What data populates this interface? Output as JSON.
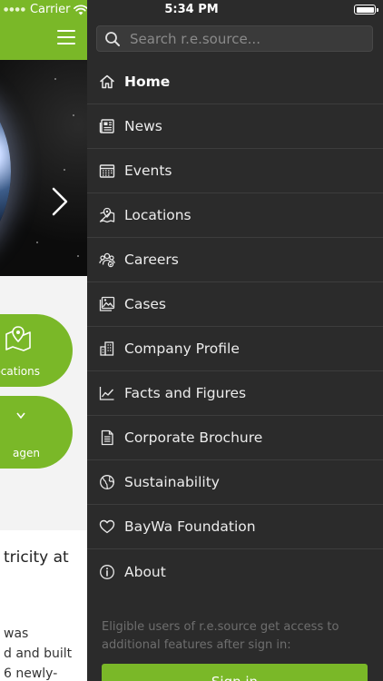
{
  "status_bar": {
    "carrier": "Carrier",
    "time": "5:34 PM"
  },
  "search": {
    "placeholder": "Search r.e.source..."
  },
  "menu": {
    "items": [
      {
        "label": "Home",
        "icon": "home-icon",
        "active": true
      },
      {
        "label": "News",
        "icon": "newspaper-icon",
        "active": false
      },
      {
        "label": "Events",
        "icon": "calendar-icon",
        "active": false
      },
      {
        "label": "Locations",
        "icon": "map-pin-icon",
        "active": false
      },
      {
        "label": "Careers",
        "icon": "people-icon",
        "active": false
      },
      {
        "label": "Cases",
        "icon": "image-icon",
        "active": false
      },
      {
        "label": "Company Profile",
        "icon": "building-icon",
        "active": false
      },
      {
        "label": "Facts and Figures",
        "icon": "line-chart-icon",
        "active": false
      },
      {
        "label": "Corporate Brochure",
        "icon": "document-icon",
        "active": false
      },
      {
        "label": "Sustainability",
        "icon": "globe-icon",
        "active": false
      },
      {
        "label": "BayWa Foundation",
        "icon": "heart-icon",
        "active": false
      },
      {
        "label": "About",
        "icon": "info-icon",
        "active": false
      }
    ]
  },
  "signin": {
    "note": "Eligible users of r.e.source get access to additional features after sign in:",
    "button_label": "Sign in"
  },
  "background_app": {
    "quick_links": [
      {
        "label": "ocations"
      },
      {
        "label": "agen"
      }
    ],
    "article": {
      "title": "tricity at",
      "lines": [
        "was",
        "d and built",
        "6 newly-"
      ]
    }
  },
  "colors": {
    "accent": "#7ab828",
    "drawer_bg": "#2b2b2b",
    "divider": "#3d3d3d"
  }
}
